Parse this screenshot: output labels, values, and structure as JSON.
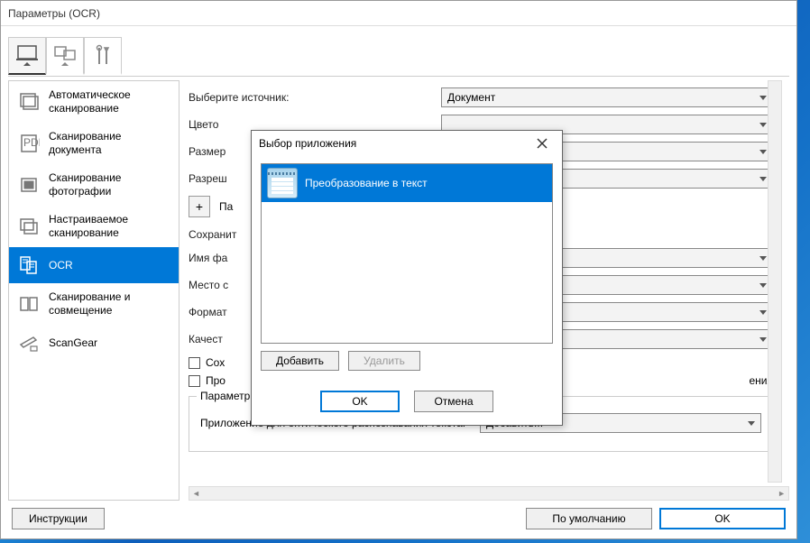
{
  "window": {
    "title": "Параметры (OCR)"
  },
  "topbar": {
    "tab1_name": "scan-from-computer",
    "tab2_name": "scan-from-device",
    "tab3_name": "tools"
  },
  "sidebar": {
    "items": [
      {
        "label": "Автоматическое сканирование"
      },
      {
        "label": "Сканирование документа"
      },
      {
        "label": "Сканирование фотографии"
      },
      {
        "label": "Настраиваемое сканирование"
      },
      {
        "label": "OCR"
      },
      {
        "label": "Сканирование и совмещение"
      },
      {
        "label": "ScanGear"
      }
    ]
  },
  "form": {
    "source_label": "Выберите источник:",
    "source_value": "Документ",
    "color_label": "Цвето",
    "size_label": "Размер",
    "resolution_label": "Разреш",
    "section_save": "Сохранит",
    "filename_label": "Имя фа",
    "saveloc_label": "Место с",
    "format_label": "Формат",
    "quality_label": "Качест",
    "plus_label": "Па",
    "checkbox1": "Сох",
    "checkbox2_prefix": "Про",
    "checkbox2_suffix": "ения",
    "app_group": "Параметры приложения",
    "ocr_app_label": "Приложение для оптического распознавания текста:",
    "ocr_app_value": "Добавить..."
  },
  "buttons": {
    "instructions": "Инструкции",
    "defaults": "По умолчанию",
    "ok": "OK"
  },
  "popup": {
    "title": "Выбор приложения",
    "item1": "Преобразование в текст",
    "add": "Добавить",
    "delete": "Удалить",
    "ok": "OK",
    "cancel": "Отмена"
  }
}
